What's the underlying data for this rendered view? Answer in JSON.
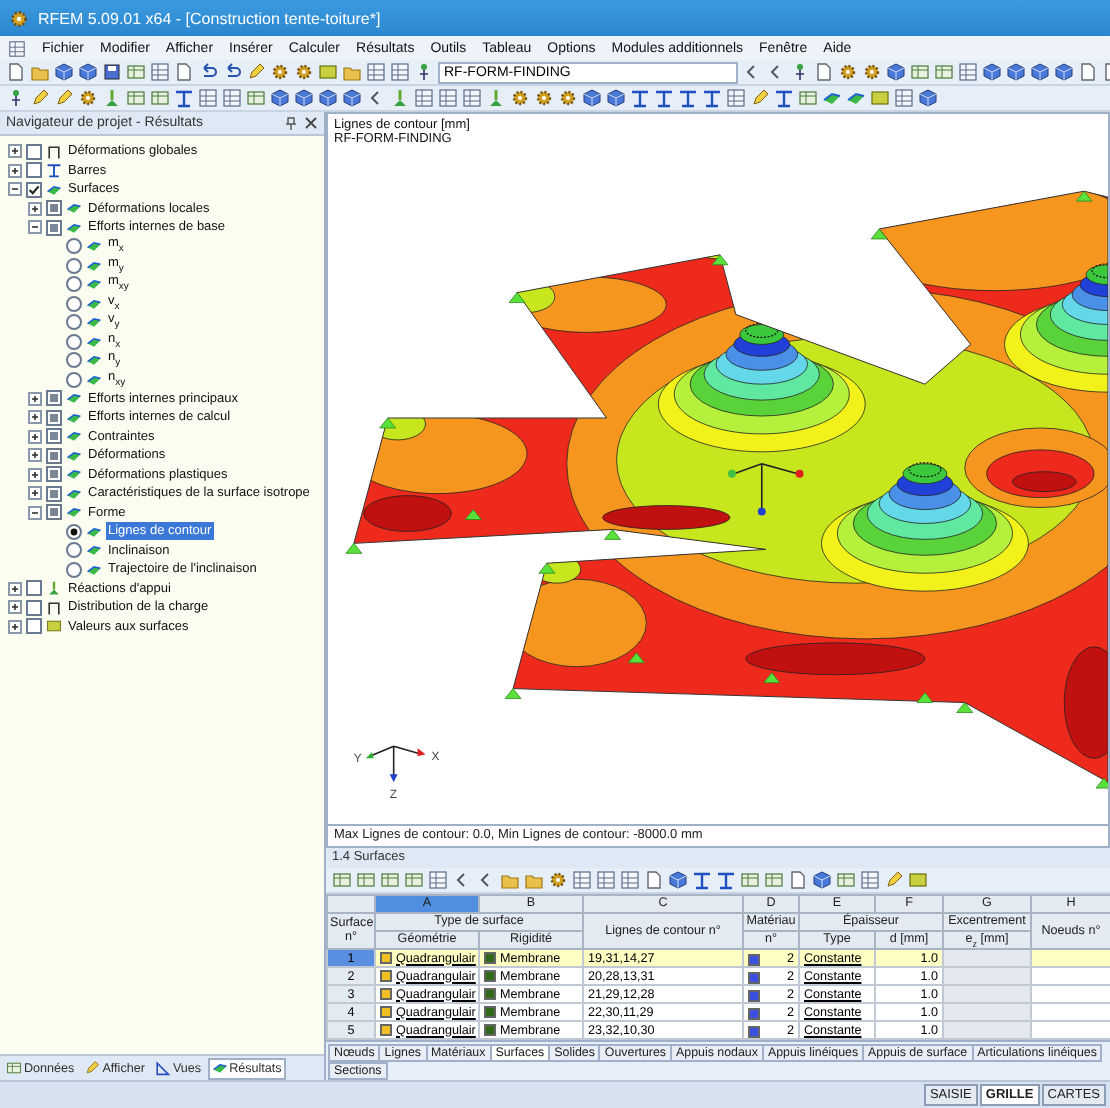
{
  "window": {
    "title": "RFEM 5.09.01 x64 - [Construction tente-toiture*]"
  },
  "menu": [
    "Fichier",
    "Modifier",
    "Afficher",
    "Insérer",
    "Calculer",
    "Résultats",
    "Outils",
    "Tableau",
    "Options",
    "Modules additionnels",
    "Fenêtre",
    "Aide"
  ],
  "toolbar": {
    "combo": "RF-FORM-FINDING"
  },
  "navigator": {
    "title": "Navigateur de projet - Résultats",
    "tree": [
      {
        "label": "Déformations globales",
        "selected": false,
        "kind": "check",
        "checked": false,
        "mixed": false,
        "expanded": false
      },
      {
        "label": "Barres",
        "selected": false,
        "kind": "check",
        "checked": false,
        "mixed": false,
        "expanded": false
      },
      {
        "label": "Surfaces",
        "selected": false,
        "kind": "check",
        "checked": true,
        "mixed": false,
        "expanded": true,
        "children": [
          {
            "label": "Déformations locales",
            "selected": false,
            "kind": "check",
            "checked": false,
            "mixed": true,
            "expanded": false
          },
          {
            "label": "Efforts internes de base",
            "selected": false,
            "kind": "check",
            "checked": false,
            "mixed": true,
            "expanded": true,
            "children": [
              {
                "label": "m$_{x}$",
                "kind": "radio",
                "selected": false
              },
              {
                "label": "m$_{y}$",
                "kind": "radio",
                "selected": false
              },
              {
                "label": "m$_{xy}$",
                "kind": "radio",
                "selected": false
              },
              {
                "label": "v$_{x}$",
                "kind": "radio",
                "selected": false
              },
              {
                "label": "v$_{y}$",
                "kind": "radio",
                "selected": false
              },
              {
                "label": "n$_{x}$",
                "kind": "radio",
                "selected": false
              },
              {
                "label": "n$_{y}$",
                "kind": "radio",
                "selected": false
              },
              {
                "label": "n$_{xy}$",
                "kind": "radio",
                "selected": false
              }
            ]
          },
          {
            "label": "Efforts internes principaux",
            "selected": false,
            "kind": "check",
            "checked": false,
            "mixed": true,
            "expanded": false
          },
          {
            "label": "Efforts internes de calcul",
            "selected": false,
            "kind": "check",
            "checked": false,
            "mixed": true,
            "expanded": false
          },
          {
            "label": "Contraintes",
            "selected": false,
            "kind": "check",
            "checked": false,
            "mixed": true,
            "expanded": false
          },
          {
            "label": "Déformations",
            "selected": false,
            "kind": "check",
            "checked": false,
            "mixed": true,
            "expanded": false
          },
          {
            "label": "Déformations plastiques",
            "selected": false,
            "kind": "check",
            "checked": false,
            "mixed": true,
            "expanded": false
          },
          {
            "label": "Caractéristiques de la surface isotrope",
            "selected": false,
            "kind": "check",
            "checked": false,
            "mixed": true,
            "expanded": false
          },
          {
            "label": "Forme",
            "selected": false,
            "kind": "check",
            "checked": false,
            "mixed": true,
            "expanded": true,
            "children": [
              {
                "label": "Lignes de contour",
                "kind": "radio",
                "selected": true
              },
              {
                "label": "Inclinaison",
                "kind": "radio",
                "selected": false
              },
              {
                "label": "Trajectoire de l'inclinaison",
                "kind": "radio",
                "selected": false
              }
            ]
          }
        ]
      },
      {
        "label": "Réactions d'appui",
        "selected": false,
        "kind": "check",
        "checked": false,
        "mixed": false,
        "expanded": false
      },
      {
        "label": "Distribution de la charge",
        "selected": false,
        "kind": "check",
        "checked": false,
        "mixed": false,
        "expanded": false
      },
      {
        "label": "Valeurs aux surfaces",
        "selected": false,
        "kind": "check",
        "checked": false,
        "mixed": false,
        "expanded": false
      }
    ],
    "tabs": [
      {
        "label": "Données",
        "selected": false
      },
      {
        "label": "Afficher",
        "selected": false
      },
      {
        "label": "Vues",
        "selected": false
      },
      {
        "label": "Résultats",
        "selected": true
      }
    ]
  },
  "viewport": {
    "title": "Lignes de contour [mm]",
    "subtitle": "RF-FORM-FINDING",
    "axes": [
      "X",
      "Y",
      "Z"
    ],
    "summary": "Max Lignes de contour: 0.0, Min Lignes de contour: -8000.0 mm"
  },
  "table": {
    "title": "1.4 Surfaces",
    "letters": [
      {
        "label": "A",
        "selected": true
      },
      {
        "label": "B",
        "selected": false
      },
      {
        "label": "C",
        "selected": false
      },
      {
        "label": "D",
        "selected": false
      },
      {
        "label": "E",
        "selected": false
      },
      {
        "label": "F",
        "selected": false
      },
      {
        "label": "G",
        "selected": false
      },
      {
        "label": "H",
        "selected": false
      }
    ],
    "head": {
      "surface": "Surface n°",
      "type": "Type de surface",
      "geometry": "Géométrie",
      "rigidity": "Rigidité",
      "lines": "Lignes de contour n°",
      "material": "Matériau",
      "material_no": "n°",
      "thickness": "Épaisseur",
      "thickness_type": "Type",
      "thickness_d": "d [mm]",
      "eccentricity": "Excentrement",
      "eccentricity_unit": "e$_{z}$ [mm]",
      "nodes": "Noeuds n°"
    },
    "rows": [
      {
        "no": "1",
        "geometry": "Quadrangulair",
        "rigidity": "Membrane",
        "lines": "19,31,14,27",
        "material": "2",
        "type": "Constante",
        "d": "1.0",
        "selected": true
      },
      {
        "no": "2",
        "geometry": "Quadrangulair",
        "rigidity": "Membrane",
        "lines": "20,28,13,31",
        "material": "2",
        "type": "Constante",
        "d": "1.0",
        "selected": false
      },
      {
        "no": "3",
        "geometry": "Quadrangulair",
        "rigidity": "Membrane",
        "lines": "21,29,12,28",
        "material": "2",
        "type": "Constante",
        "d": "1.0",
        "selected": false
      },
      {
        "no": "4",
        "geometry": "Quadrangulair",
        "rigidity": "Membrane",
        "lines": "22,30,11,29",
        "material": "2",
        "type": "Constante",
        "d": "1.0",
        "selected": false
      },
      {
        "no": "5",
        "geometry": "Quadrangulair",
        "rigidity": "Membrane",
        "lines": "23,32,10,30",
        "material": "2",
        "type": "Constante",
        "d": "1.0",
        "selected": false
      }
    ]
  },
  "sheet_tabs": [
    {
      "label": "Nœuds",
      "selected": false
    },
    {
      "label": "Lignes",
      "selected": false
    },
    {
      "label": "Matériaux",
      "selected": false
    },
    {
      "label": "Surfaces",
      "selected": true
    },
    {
      "label": "Solides",
      "selected": false
    },
    {
      "label": "Ouvertures",
      "selected": false
    },
    {
      "label": "Appuis nodaux",
      "selected": false
    },
    {
      "label": "Appuis linéiques",
      "selected": false
    },
    {
      "label": "Appuis de surface",
      "selected": false
    },
    {
      "label": "Articulations linéiques",
      "selected": false
    },
    {
      "label": "Sections",
      "selected": false
    }
  ],
  "status_bar": [
    {
      "label": "SAISIE",
      "selected": false
    },
    {
      "label": "GRILLE",
      "selected": true
    },
    {
      "label": "CARTES",
      "selected": false
    }
  ]
}
